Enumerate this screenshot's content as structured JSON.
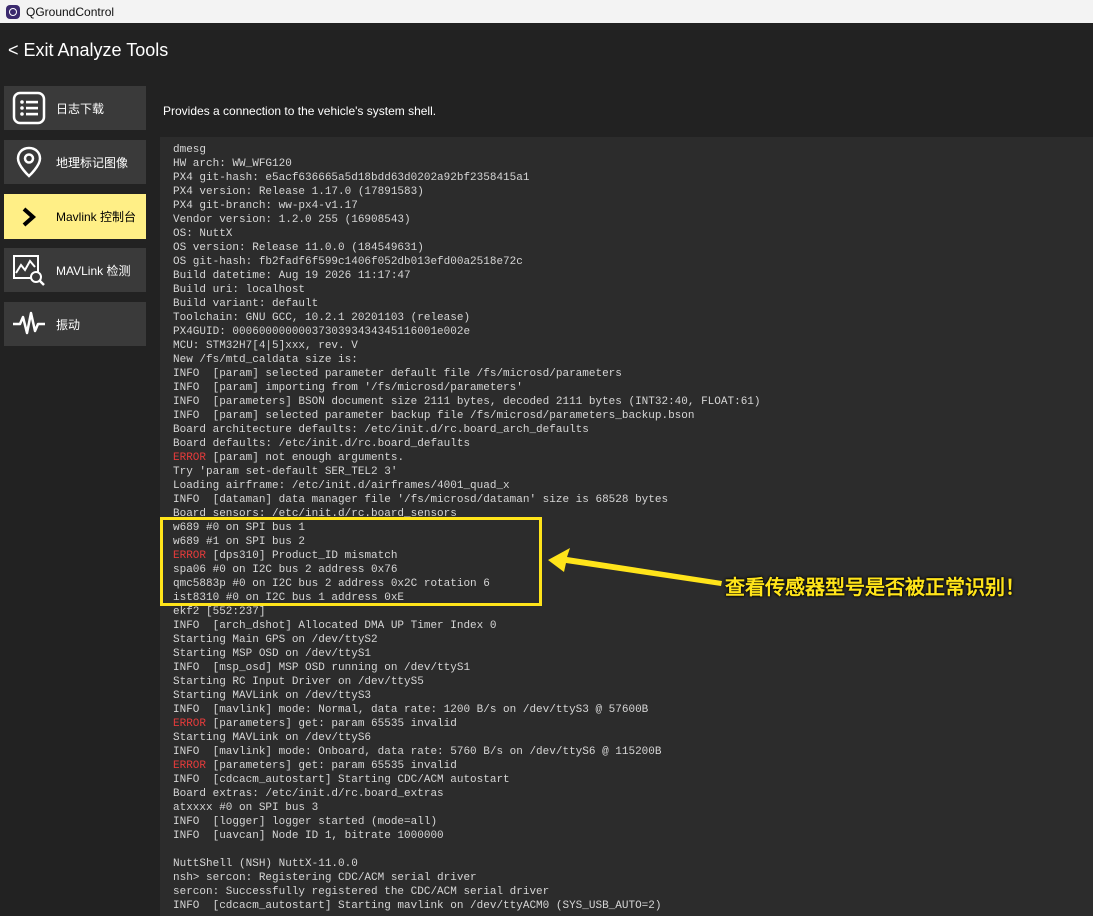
{
  "window": {
    "title": "QGroundControl"
  },
  "header": {
    "exit_label": "< Exit Analyze Tools"
  },
  "sidebar": {
    "items": [
      {
        "label": "日志下载",
        "icon": "list-icon",
        "active": false
      },
      {
        "label": "地理标记图像",
        "icon": "location-pin-icon",
        "active": false
      },
      {
        "label": "Mavlink 控制台",
        "icon": "chevron-right-icon",
        "active": true
      },
      {
        "label": "MAVLink 检测",
        "icon": "chart-magnifier-icon",
        "active": false
      },
      {
        "label": "振动",
        "icon": "waveform-icon",
        "active": false
      }
    ]
  },
  "main": {
    "description": "Provides a connection to the vehicle's system shell."
  },
  "console": {
    "lines": [
      {
        "text": "dmesg"
      },
      {
        "text": "HW arch: WW_WFG120"
      },
      {
        "text": "PX4 git-hash: e5acf636665a5d18bdd63d0202a92bf2358415a1"
      },
      {
        "text": "PX4 version: Release 1.17.0 (17891583)"
      },
      {
        "text": "PX4 git-branch: ww-px4-v1.17"
      },
      {
        "text": "Vendor version: 1.2.0 255 (16908543)"
      },
      {
        "text": "OS: NuttX"
      },
      {
        "text": "OS version: Release 11.0.0 (184549631)"
      },
      {
        "text": "OS git-hash: fb2fadf6f599c1406f052db013efd00a2518e72c"
      },
      {
        "text": "Build datetime: Aug 19 2026 11:17:47"
      },
      {
        "text": "Build uri: localhost"
      },
      {
        "text": "Build variant: default"
      },
      {
        "text": "Toolchain: GNU GCC, 10.2.1 20201103 (release)"
      },
      {
        "text": "PX4GUID: 0006000000003730393434345116001e002e"
      },
      {
        "text": "MCU: STM32H7[4|5]xxx, rev. V"
      },
      {
        "text": "New /fs/mtd_caldata size is:"
      },
      {
        "text": "INFO  [param] selected parameter default file /fs/microsd/parameters"
      },
      {
        "text": "INFO  [param] importing from '/fs/microsd/parameters'"
      },
      {
        "text": "INFO  [parameters] BSON document size 2111 bytes, decoded 2111 bytes (INT32:40, FLOAT:61)"
      },
      {
        "text": "INFO  [param] selected parameter backup file /fs/microsd/parameters_backup.bson"
      },
      {
        "text": "Board architecture defaults: /etc/init.d/rc.board_arch_defaults"
      },
      {
        "text": "Board defaults: /etc/init.d/rc.board_defaults"
      },
      {
        "prefix": "ERROR",
        "text": " [param] not enough arguments."
      },
      {
        "text": "Try 'param set-default SER_TEL2 3'"
      },
      {
        "text": "Loading airframe: /etc/init.d/airframes/4001_quad_x"
      },
      {
        "text": "INFO  [dataman] data manager file '/fs/microsd/dataman' size is 68528 bytes"
      },
      {
        "text": "Board sensors: /etc/init.d/rc.board_sensors"
      },
      {
        "text": "w689 #0 on SPI bus 1"
      },
      {
        "text": "w689 #1 on SPI bus 2"
      },
      {
        "prefix": "ERROR",
        "text": " [dps310] Product_ID mismatch"
      },
      {
        "text": "spa06 #0 on I2C bus 2 address 0x76"
      },
      {
        "text": "qmc5883p #0 on I2C bus 2 address 0x2C rotation 6"
      },
      {
        "text": "ist8310 #0 on I2C bus 1 address 0xE"
      },
      {
        "text": "ekf2 [552:237]"
      },
      {
        "text": "INFO  [arch_dshot] Allocated DMA UP Timer Index 0"
      },
      {
        "text": "Starting Main GPS on /dev/ttyS2"
      },
      {
        "text": "Starting MSP OSD on /dev/ttyS1"
      },
      {
        "text": "INFO  [msp_osd] MSP OSD running on /dev/ttyS1"
      },
      {
        "text": "Starting RC Input Driver on /dev/ttyS5"
      },
      {
        "text": "Starting MAVLink on /dev/ttyS3"
      },
      {
        "text": "INFO  [mavlink] mode: Normal, data rate: 1200 B/s on /dev/ttyS3 @ 57600B"
      },
      {
        "prefix": "ERROR",
        "text": " [parameters] get: param 65535 invalid"
      },
      {
        "text": "Starting MAVLink on /dev/ttyS6"
      },
      {
        "text": "INFO  [mavlink] mode: Onboard, data rate: 5760 B/s on /dev/ttyS6 @ 115200B"
      },
      {
        "prefix": "ERROR",
        "text": " [parameters] get: param 65535 invalid"
      },
      {
        "text": "INFO  [cdcacm_autostart] Starting CDC/ACM autostart"
      },
      {
        "text": "Board extras: /etc/init.d/rc.board_extras"
      },
      {
        "text": "atxxxx #0 on SPI bus 3"
      },
      {
        "text": "INFO  [logger] logger started (mode=all)"
      },
      {
        "text": "INFO  [uavcan] Node ID 1, bitrate 1000000"
      },
      {
        "text": ""
      },
      {
        "text": "NuttShell (NSH) NuttX-11.0.0"
      },
      {
        "text": "nsh> sercon: Registering CDC/ACM serial driver"
      },
      {
        "text": "sercon: Successfully registered the CDC/ACM serial driver"
      },
      {
        "text": "INFO  [cdcacm_autostart] Starting mavlink on /dev/ttyACM0 (SYS_USB_AUTO=2)"
      }
    ]
  },
  "annotation": {
    "text": "查看传感器型号是否被正常识别！",
    "color": "#ffe41a"
  },
  "colors": {
    "error": "#e53b3b",
    "active_nav": "#ffef86",
    "nav_bg": "#3a3a3a"
  }
}
